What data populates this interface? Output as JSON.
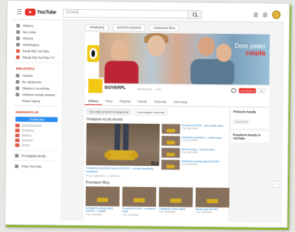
{
  "app": {
    "logo_text": "YouTube"
  },
  "search": {
    "placeholder": "Szukaj"
  },
  "sidebar": {
    "items": [
      {
        "label": "Główna",
        "icon": "home-icon"
      },
      {
        "label": "Na czasie",
        "icon": "trending-icon"
      },
      {
        "label": "Historia",
        "icon": "history-icon"
      },
      {
        "label": "Subskrypcje",
        "icon": "subscriptions-icon"
      },
      {
        "label": "Kanał Mój YouTube",
        "icon": "channel-icon"
      },
      {
        "label": "Stacja Mój YouTube TV",
        "icon": "tv-icon"
      }
    ],
    "library_heading": "BIBLIOTEKA",
    "library": [
      {
        "label": "Historia"
      },
      {
        "label": "Do obejrzenia"
      },
      {
        "label": "Obejrzeć na później"
      },
      {
        "label": "Ulubione kanały dodane"
      },
      {
        "label": "Pokaż więcej"
      }
    ],
    "subs_heading": "SUBSKRYPCJE",
    "subs_button": "Subskrybuj",
    "subs": [
      "",
      "",
      "",
      "",
      ""
    ],
    "footer": [
      {
        "label": "Przeglądaj kanały",
        "icon": "browse-icon"
      },
      {
        "label": "Filmy YouTube",
        "icon": "movies-icon"
      }
    ]
  },
  "chips": [
    "Subskrybuj",
    "ISOVER Krzysztof",
    "Ustawienia filmu"
  ],
  "banner": {
    "tagline_1": "Dom pełen",
    "tagline_2": "ciepła"
  },
  "channel": {
    "name": "ISOVERPL",
    "subscribers": "Subskrybuje · 1 tys.",
    "subscribe_label": "Subskrybuj",
    "subscribe_count": "1k"
  },
  "tabs": [
    "Główna",
    "Filmy",
    "Playlisty",
    "Kanały",
    "Dyskusja",
    "Informacje"
  ],
  "content": {
    "tabs": [
      "Dla użytkowników nowicjuszów",
      "Powracający widzowie"
    ],
    "featured_section": "Dostępne na tej stronie",
    "featured": {
      "title": "Ocieplenie poddasza wełną ISOVER – montaż pomiędzy krokwiami",
      "meta": "90 tys. wyświetleń · 2 lata temu",
      "duration": "4:30"
    },
    "list": [
      {
        "title": "Poradnik ISOVER – jak ocieplić dach",
        "meta": "1 tys. wyświetleń"
      },
      {
        "title": "Ocieplenie poddasza – część druga",
        "meta": "2 tys. wyświetleń"
      },
      {
        "title": "Montaż wełny – krok po kroku",
        "meta": "3 tys. wyświetleń"
      },
      {
        "title": "Ocieplenie podłogi wełną ISOVER",
        "meta": "1 tys. wyświetleń"
      }
    ],
    "section2": "Przesłane filmy",
    "row2": [
      {
        "title": "Ocieplenie podłogi wełną ISOVER – montaż",
        "meta": "2 tys. wyświetleń"
      },
      {
        "title": "Poradnik ISOVER – ocieplenie ścian",
        "meta": "1 tys. wyświetleń"
      },
      {
        "title": "Ocieplenie stropu wełną",
        "meta": "4 tys. wyświetleń"
      },
      {
        "title": "Montaż płyt ISOVER",
        "meta": "2 tys. wyświetleń"
      }
    ]
  },
  "right": [
    {
      "title": "Polecane kanały",
      "sub": "Subskrybuj"
    },
    {
      "title": "Popularne kanały w YouTube",
      "sub": ""
    }
  ],
  "colors": {
    "brand": "#e52d27",
    "link": "#167ac6",
    "frame_shadow": "#8ab42a"
  }
}
